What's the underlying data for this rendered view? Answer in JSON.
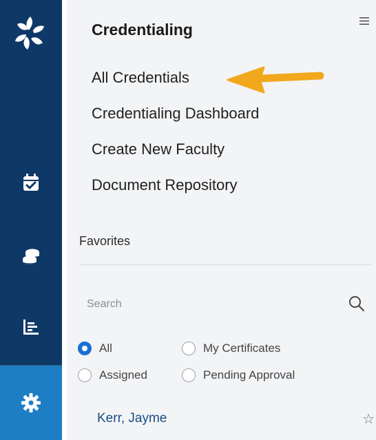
{
  "nav": {
    "items": [
      {
        "name": "calendar",
        "icon": "calendar-check-icon",
        "active": false
      },
      {
        "name": "database",
        "icon": "database-icon",
        "active": false
      },
      {
        "name": "reports",
        "icon": "bar-chart-icon",
        "active": false
      },
      {
        "name": "settings",
        "icon": "gear-icon",
        "active": true
      }
    ],
    "colors": {
      "rail": "#0e3866",
      "active": "#1d7ec4"
    }
  },
  "menu": {
    "title": "Credentialing",
    "items": [
      {
        "label": "All Credentials"
      },
      {
        "label": "Credentialing Dashboard"
      },
      {
        "label": "Create New Faculty"
      },
      {
        "label": "Document Repository"
      }
    ]
  },
  "favorites": {
    "label": "Favorites",
    "search": {
      "placeholder": "Search",
      "value": ""
    },
    "filters": [
      {
        "label": "All",
        "checked": true
      },
      {
        "label": "My Certificates",
        "checked": false
      },
      {
        "label": "Assigned",
        "checked": false
      },
      {
        "label": "Pending Approval",
        "checked": false
      }
    ],
    "items": [
      {
        "name": "Kerr, Jayme"
      }
    ]
  },
  "annotation": {
    "color": "#f2a81d"
  }
}
